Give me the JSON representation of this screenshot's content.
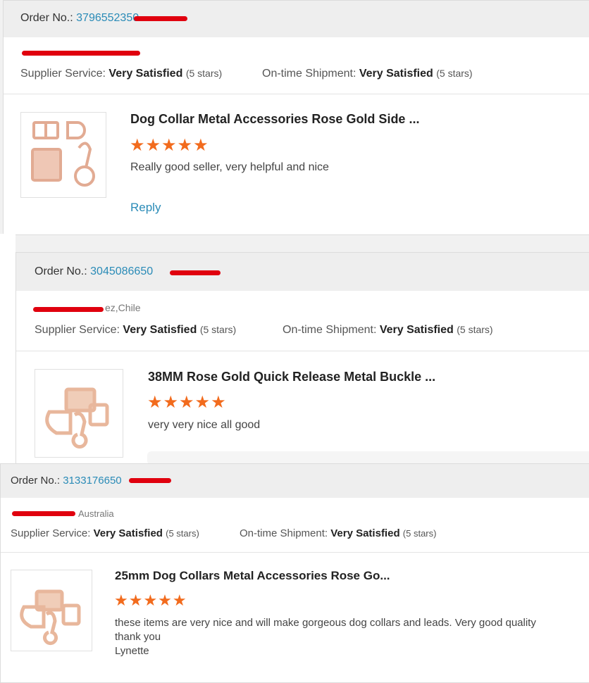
{
  "reviews": [
    {
      "order_label": "Order No.:",
      "order_number": "3796552350",
      "buyer_location": "",
      "supplier_service_label": "Supplier Service:",
      "supplier_service_value": "Very Satisfied",
      "supplier_service_stars": "(5 stars)",
      "shipment_label": "On-time Shipment:",
      "shipment_value": "Very Satisfied",
      "shipment_stars": "(5 stars)",
      "product_title": "Dog Collar Metal Accessories Rose Gold Side ...",
      "rating": 5,
      "stars_text": "★★★★★",
      "comment": "Really good seller, very helpful and nice",
      "reply_label": "Reply"
    },
    {
      "order_label": "Order No.:",
      "order_number": "3045086650",
      "buyer_location": "ez,Chile",
      "supplier_service_label": "Supplier Service:",
      "supplier_service_value": "Very Satisfied",
      "supplier_service_stars": "(5 stars)",
      "shipment_label": "On-time Shipment:",
      "shipment_value": "Very Satisfied",
      "shipment_stars": "(5 stars)",
      "product_title": "38MM Rose Gold Quick Release Metal Buckle ...",
      "rating": 5,
      "stars_text": "★★★★★",
      "comment": "very very nice all good"
    },
    {
      "order_label": "Order No.:",
      "order_number": "3133176650",
      "buyer_location": "Australia",
      "supplier_service_label": "Supplier Service:",
      "supplier_service_value": "Very Satisfied",
      "supplier_service_stars": "(5 stars)",
      "shipment_label": "On-time Shipment:",
      "shipment_value": "Very Satisfied",
      "shipment_stars": "(5 stars)",
      "product_title": "25mm Dog Collars Metal Accessories Rose Go...",
      "rating": 5,
      "stars_text": "★★★★★",
      "comment_lines": [
        "these items are very nice and will make gorgeous dog collars and leads. Very good quality",
        "thank you",
        "Lynette"
      ]
    }
  ],
  "colors": {
    "link": "#2a8bb7",
    "star": "#f26b1d",
    "redaction": "#e0000e",
    "product_rose_gold": "#e6b39c"
  },
  "icons": {
    "rating_star": "star-icon"
  }
}
